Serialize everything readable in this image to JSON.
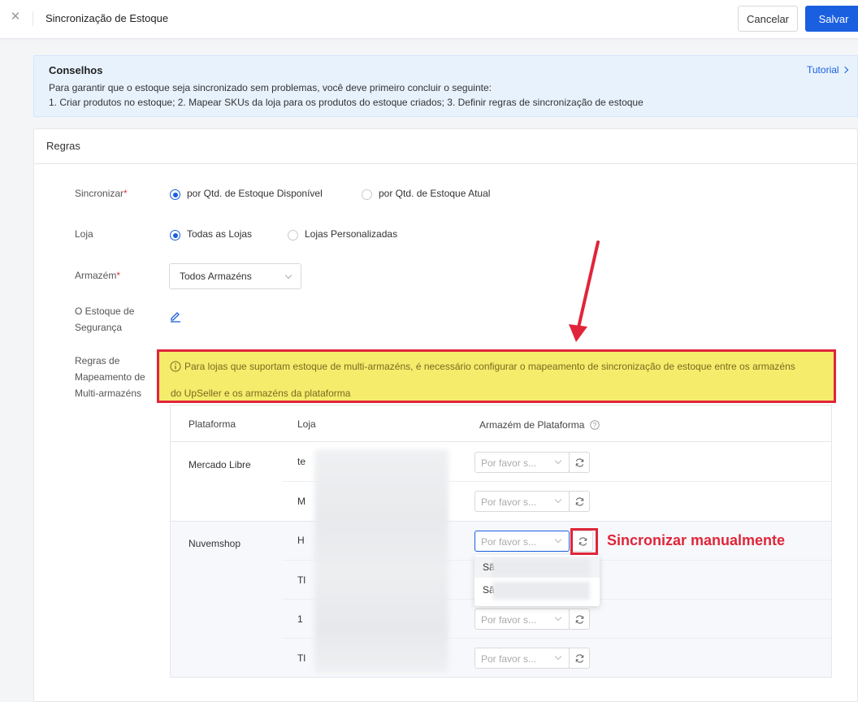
{
  "header": {
    "title": "Sincronização de Estoque",
    "cancel_label": "Cancelar",
    "save_label": "Salvar"
  },
  "tips": {
    "title": "Conselhos",
    "line1": "Para garantir que o estoque seja sincronizado sem problemas, você deve primeiro concluir o seguinte:",
    "line2": "1. Criar produtos no estoque;   2. Mapear SKUs da loja para os produtos do estoque criados;   3. Definir regras de sincronização de estoque",
    "tutorial_label": "Tutorial"
  },
  "rules": {
    "title": "Regras",
    "sync": {
      "label": "Sincronizar",
      "options": [
        "por Qtd. de Estoque Disponível",
        "por Qtd. de Estoque Atual"
      ],
      "selected": "por Qtd. de Estoque Disponível"
    },
    "store": {
      "label": "Loja",
      "options": [
        "Todas as Lojas",
        "Lojas Personalizadas"
      ],
      "selected": "Todas as Lojas"
    },
    "warehouse": {
      "label": "Armazém",
      "value": "Todos Armazéns"
    },
    "safety_stock": {
      "label_line1": "O Estoque de",
      "label_line2": "Segurança"
    },
    "mapping": {
      "label_line1": "Regras de",
      "label_line2": "Mapeamento de",
      "label_line3": "Multi-armazéns",
      "warning_line1": "Para lojas que suportam estoque de multi-armazéns, é necessário configurar o mapeamento de sincronização de estoque entre os armazéns",
      "warning_line2": "do UpSeller e os armazéns da plataforma"
    }
  },
  "table": {
    "columns": [
      "Plataforma",
      "Loja",
      "Armazém de Plataforma"
    ],
    "placeholder": "Por favor s...",
    "groups": [
      {
        "platform": "Mercado Libre",
        "shops": [
          "te",
          "M"
        ]
      },
      {
        "platform": "Nuvemshop",
        "shops": [
          "H",
          "Tl",
          "1",
          "Tl"
        ]
      }
    ],
    "dropdown_options": [
      "Sã",
      "Sã"
    ]
  },
  "annotation": {
    "label": "Sincronizar manualmente"
  },
  "colors": {
    "primary": "#1a5fe0",
    "annotation_red": "#e0253a",
    "warning_bg": "#f5ec6c",
    "tips_bg": "#e8f2fd"
  }
}
